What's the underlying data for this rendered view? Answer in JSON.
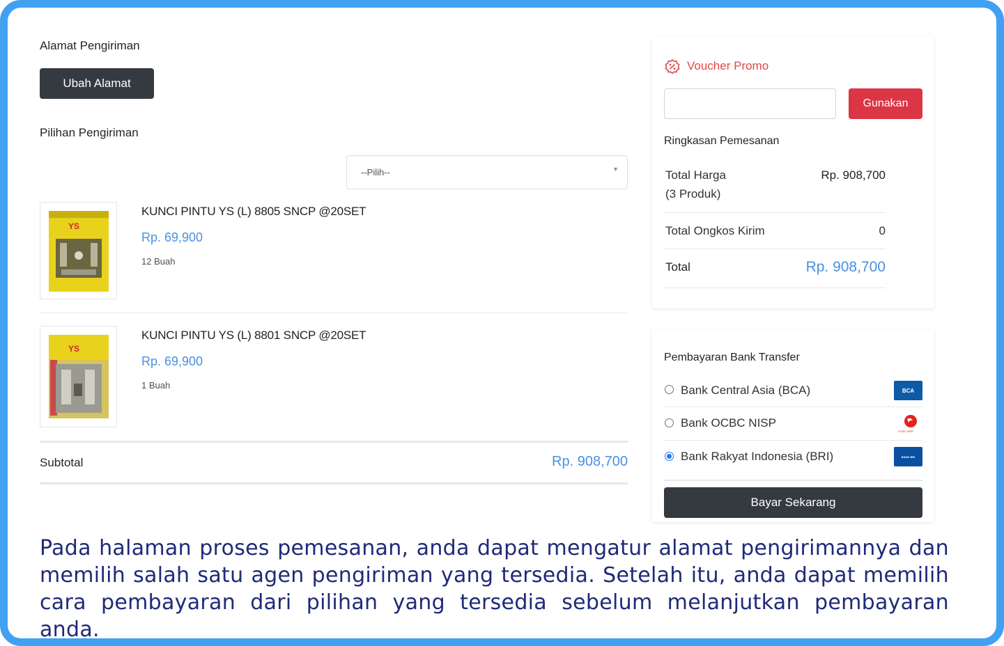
{
  "shipping": {
    "address_title": "Alamat Pengiriman",
    "change_address_button": "Ubah Alamat",
    "options_title": "Pilihan Pengiriman",
    "select_value": "--Pilih--"
  },
  "products": [
    {
      "name": "KUNCI PINTU YS (L) 8805 SNCP @20SET",
      "price": "Rp. 69,900",
      "qty": "12 Buah",
      "thumb_brand": "YS"
    },
    {
      "name": "KUNCI PINTU YS (L) 8801 SNCP @20SET",
      "price": "Rp. 69,900",
      "qty": "1 Buah",
      "thumb_brand": "YS"
    }
  ],
  "subtotal": {
    "label": "Subtotal",
    "value": "Rp. 908,700"
  },
  "voucher": {
    "title": "Voucher Promo",
    "input_value": "",
    "apply_button": "Gunakan"
  },
  "summary": {
    "title": "Ringkasan Pemesanan",
    "total_price_label": "Total Harga",
    "total_price_count": "(3 Produk)",
    "total_price_value": "Rp. 908,700",
    "shipping_cost_label": "Total Ongkos Kirim",
    "shipping_cost_value": "0",
    "total_label": "Total",
    "total_value": "Rp. 908,700"
  },
  "payment": {
    "title": "Pembayaran Bank Transfer",
    "banks": [
      {
        "name": "Bank Central Asia (BCA)",
        "logo_text": "BCA",
        "selected": false
      },
      {
        "name": "Bank OCBC NISP",
        "logo_text": "OCBC NISP",
        "selected": false
      },
      {
        "name": "Bank Rakyat Indonesia (BRI)",
        "logo_text": "BANK BRI",
        "selected": true
      }
    ],
    "pay_button": "Bayar Sekarang"
  },
  "caption": "Pada halaman  proses pemesanan, anda dapat mengatur alamat pengirimannya dan memilih salah satu agen pengiriman yang tersedia. Setelah itu, anda dapat memilih cara pembayaran dari pilihan yang tersedia sebelum melanjutkan pembayaran anda.",
  "colors": {
    "frame": "#42a0f2",
    "price": "#4a90e2",
    "voucher": "#e04848",
    "apply": "#dc3545",
    "dark_button": "#343a40",
    "caption": "#1e2a78"
  },
  "icons": {
    "voucher": "voucher-badge-icon",
    "select": "chevron-down-icon"
  }
}
